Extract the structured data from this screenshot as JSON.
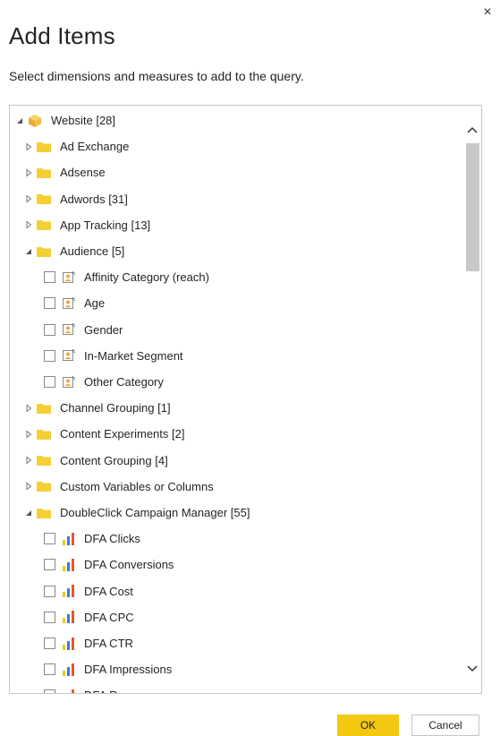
{
  "dialog": {
    "title": "Add Items",
    "subtitle": "Select dimensions and measures to add to the query.",
    "close_glyph": "×"
  },
  "colors": {
    "folder": "#f2c811",
    "accent_button": "#f2c811",
    "border": "#c8c6c4"
  },
  "tree": {
    "root": {
      "label": "Website [28]",
      "icon": "cube-icon",
      "expanded": true
    },
    "items": [
      {
        "label": "Ad Exchange",
        "type": "folder",
        "expanded": false
      },
      {
        "label": "Adsense",
        "type": "folder",
        "expanded": false
      },
      {
        "label": "Adwords [31]",
        "type": "folder",
        "expanded": false
      },
      {
        "label": "App Tracking [13]",
        "type": "folder",
        "expanded": false
      },
      {
        "label": "Audience [5]",
        "type": "folder",
        "expanded": true
      },
      {
        "label": "Affinity Category (reach)",
        "type": "dimension",
        "checked": false
      },
      {
        "label": "Age",
        "type": "dimension",
        "checked": false
      },
      {
        "label": "Gender",
        "type": "dimension",
        "checked": false
      },
      {
        "label": "In-Market Segment",
        "type": "dimension",
        "checked": false
      },
      {
        "label": "Other Category",
        "type": "dimension",
        "checked": false
      },
      {
        "label": "Channel Grouping [1]",
        "type": "folder",
        "expanded": false
      },
      {
        "label": "Content Experiments [2]",
        "type": "folder",
        "expanded": false
      },
      {
        "label": "Content Grouping [4]",
        "type": "folder",
        "expanded": false
      },
      {
        "label": "Custom Variables or Columns",
        "type": "folder",
        "expanded": false
      },
      {
        "label": "DoubleClick Campaign Manager [55]",
        "type": "folder",
        "expanded": true
      },
      {
        "label": "DFA Clicks",
        "type": "measure",
        "checked": false
      },
      {
        "label": "DFA Conversions",
        "type": "measure",
        "checked": false
      },
      {
        "label": "DFA Cost",
        "type": "measure",
        "checked": false
      },
      {
        "label": "DFA CPC",
        "type": "measure",
        "checked": false
      },
      {
        "label": "DFA CTR",
        "type": "measure",
        "checked": false
      },
      {
        "label": "DFA Impressions",
        "type": "measure",
        "checked": false
      },
      {
        "label": "DFA Revenue",
        "type": "measure",
        "checked": false
      }
    ]
  },
  "buttons": {
    "ok": "OK",
    "cancel": "Cancel"
  }
}
